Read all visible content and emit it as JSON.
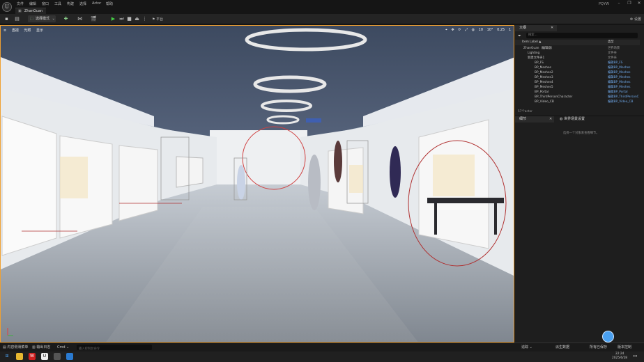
{
  "menu": [
    "文件",
    "编辑",
    "窗口",
    "工具",
    "构建",
    "选择",
    "Actor",
    "帮助"
  ],
  "document_tab": "ZhanGuan",
  "project_name": "PQYW",
  "toolbar": {
    "mode_label": "选择模式",
    "platform_label": "平台",
    "settings_label": "设置"
  },
  "viewport": {
    "left_controls": [
      "透视",
      "光照",
      "显示"
    ],
    "right_readouts": [
      "10",
      "10°",
      "0.25",
      "1"
    ]
  },
  "outliner": {
    "tab_label": "大纲",
    "search_placeholder": "搜索...",
    "col_label": "Item Label ▲",
    "col_type": "类型",
    "rows": [
      {
        "label": "ZhanGuan（编辑器）",
        "type": "世界场景"
      },
      {
        "label": "Lighting",
        "type": "文件夹"
      },
      {
        "label": "新建文件夹1",
        "type": "文件夹"
      },
      {
        "label": "BP_FS",
        "type": "编辑BP_FS"
      },
      {
        "label": "BP_Meshes",
        "type": "编辑BP_Meshes"
      },
      {
        "label": "BP_Meshes2",
        "type": "编辑BP_Meshes"
      },
      {
        "label": "BP_Meshes3",
        "type": "编辑BP_Meshes"
      },
      {
        "label": "BP_Meshes4",
        "type": "编辑BP_Meshes"
      },
      {
        "label": "BP_Meshes5",
        "type": "编辑BP_Meshes"
      },
      {
        "label": "BP_Portal",
        "type": "编辑BP_Portal"
      },
      {
        "label": "BP_ThirdPersonCharacter",
        "type": "编辑BP_ThirdPersonC"
      },
      {
        "label": "BP_Video_CB",
        "type": "编辑BP_Video_CB"
      }
    ],
    "actor_count": "57个actor"
  },
  "details": {
    "tab_details": "细节",
    "tab_world": "世界场景设置",
    "empty_message": "选择一个对象来查看细节。"
  },
  "statusbar": {
    "content_drawer": "内容侧滑菜单",
    "output_log": "输出日志",
    "cmd": "Cmd",
    "cmd_placeholder": "输入控制台命令",
    "trace": "追踪",
    "derived_data": "派生数据",
    "all_saved": "所有已保存",
    "source_control": "版本控制"
  },
  "taskbar": {
    "time": "22:24",
    "date": "2025/6/28"
  }
}
